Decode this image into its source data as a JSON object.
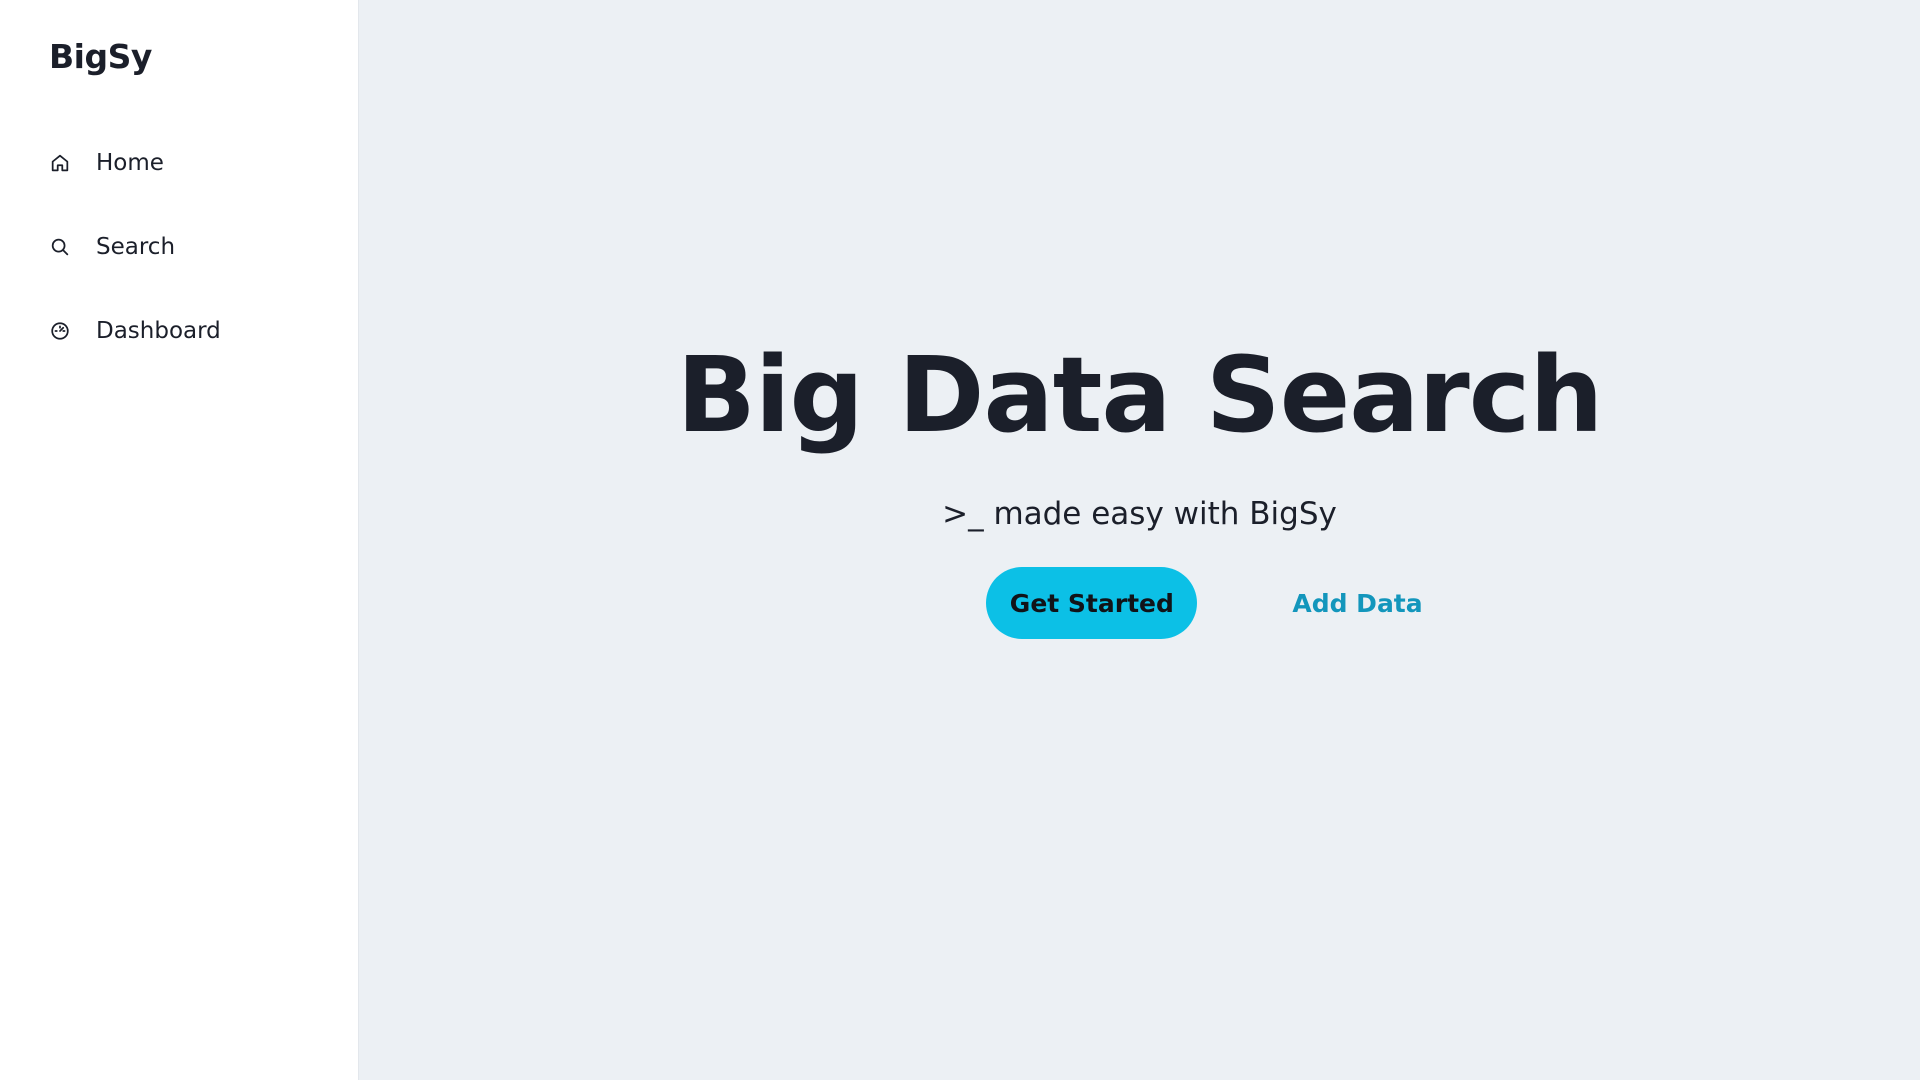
{
  "sidebar": {
    "brand": "BigSy",
    "items": [
      {
        "label": "Home",
        "icon": "home-icon"
      },
      {
        "label": "Search",
        "icon": "search-icon"
      },
      {
        "label": "Dashboard",
        "icon": "gauge-icon"
      }
    ]
  },
  "hero": {
    "title": "Big Data Search",
    "subtitle": ">_ made easy with BigSy",
    "primary_button": "Get Started",
    "secondary_link": "Add Data"
  },
  "colors": {
    "sidebar_bg": "#ffffff",
    "main_bg": "#ecf0f4",
    "text": "#1b1f2a",
    "accent": "#0cc0e6",
    "link": "#1396bc"
  }
}
